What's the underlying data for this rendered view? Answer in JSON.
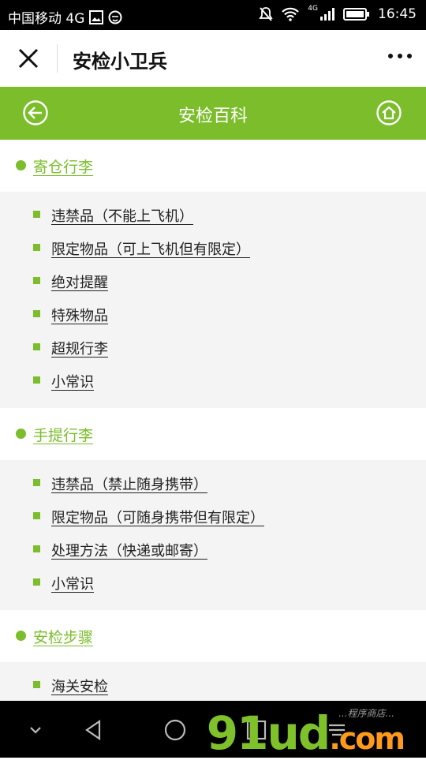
{
  "status_bar": {
    "carrier": "中国移动 4G",
    "time": "16:45",
    "network_label": "4G"
  },
  "title_bar": {
    "title": "安检小卫兵"
  },
  "green_bar": {
    "title": "安检百科"
  },
  "sections": [
    {
      "heading": "寄仓行李",
      "items": [
        "违禁品（不能上飞机）",
        "限定物品（可上飞机但有限定）",
        "绝对提醒",
        "特殊物品",
        "超规行李",
        "小常识"
      ]
    },
    {
      "heading": "手提行李",
      "items": [
        "违禁品（禁止随身携带）",
        "限定物品（可随身携带但有限定）",
        "处理方法（快递或邮寄）",
        "小常识"
      ]
    },
    {
      "heading": "安检步骤",
      "items": [
        "海关安检"
      ]
    }
  ],
  "watermark": {
    "brand": "91ud",
    "domain": ".com",
    "tagline": "...程序商店..."
  },
  "colors": {
    "accent": "#7bbd2b",
    "list_bg": "#f4f4f4"
  }
}
